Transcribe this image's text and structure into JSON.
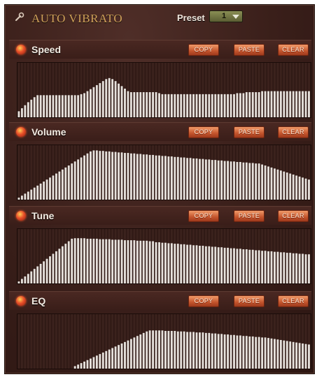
{
  "header": {
    "title": "AUTO VIBRATO",
    "preset_label": "Preset",
    "preset_value": "1"
  },
  "colors": {
    "accent": "#d2a25a",
    "button": "#c4542c",
    "graph_bg": "#2e1814",
    "bar": "#e6e1dc"
  },
  "sections": [
    {
      "label": "Speed",
      "copy": "COPY",
      "paste": "PASTE",
      "clear": "CLEAR",
      "envelope": [
        0.12,
        0.18,
        0.24,
        0.3,
        0.35,
        0.4,
        0.44,
        0.44,
        0.44,
        0.44,
        0.44,
        0.44,
        0.44,
        0.44,
        0.44,
        0.44,
        0.44,
        0.44,
        0.44,
        0.44,
        0.46,
        0.48,
        0.52,
        0.56,
        0.6,
        0.64,
        0.68,
        0.72,
        0.76,
        0.78,
        0.76,
        0.72,
        0.67,
        0.62,
        0.57,
        0.52,
        0.5,
        0.5,
        0.5,
        0.5,
        0.5,
        0.5,
        0.5,
        0.5,
        0.5,
        0.48,
        0.46,
        0.46,
        0.46,
        0.46,
        0.46,
        0.46,
        0.46,
        0.46,
        0.46,
        0.46,
        0.46,
        0.46,
        0.46,
        0.46,
        0.46,
        0.46,
        0.46,
        0.46,
        0.46,
        0.46,
        0.46,
        0.46,
        0.46,
        0.46,
        0.48,
        0.48,
        0.48,
        0.5,
        0.5,
        0.5,
        0.5,
        0.5,
        0.52,
        0.52,
        0.52,
        0.52,
        0.52,
        0.52,
        0.52,
        0.52,
        0.52,
        0.52,
        0.52,
        0.52,
        0.52,
        0.52,
        0.52,
        0.52
      ]
    },
    {
      "label": "Volume",
      "copy": "COPY",
      "paste": "PASTE",
      "clear": "CLEAR",
      "envelope": [
        0.04,
        0.08,
        0.12,
        0.16,
        0.2,
        0.24,
        0.28,
        0.32,
        0.36,
        0.4,
        0.44,
        0.48,
        0.52,
        0.56,
        0.6,
        0.64,
        0.68,
        0.72,
        0.76,
        0.8,
        0.84,
        0.88,
        0.92,
        0.96,
        0.98,
        0.98,
        0.97,
        0.97,
        0.96,
        0.96,
        0.95,
        0.95,
        0.94,
        0.94,
        0.93,
        0.93,
        0.92,
        0.92,
        0.91,
        0.91,
        0.9,
        0.9,
        0.89,
        0.89,
        0.88,
        0.88,
        0.87,
        0.87,
        0.86,
        0.86,
        0.85,
        0.85,
        0.84,
        0.84,
        0.83,
        0.83,
        0.82,
        0.82,
        0.81,
        0.81,
        0.8,
        0.8,
        0.79,
        0.79,
        0.78,
        0.78,
        0.77,
        0.77,
        0.76,
        0.76,
        0.75,
        0.75,
        0.74,
        0.74,
        0.73,
        0.73,
        0.72,
        0.72,
        0.7,
        0.68,
        0.66,
        0.64,
        0.62,
        0.6,
        0.58,
        0.56,
        0.54,
        0.52,
        0.5,
        0.48,
        0.46,
        0.44,
        0.42,
        0.4
      ]
    },
    {
      "label": "Tune",
      "copy": "COPY",
      "paste": "PASTE",
      "clear": "CLEAR",
      "envelope": [
        0.04,
        0.09,
        0.14,
        0.19,
        0.24,
        0.29,
        0.34,
        0.39,
        0.44,
        0.49,
        0.54,
        0.59,
        0.64,
        0.69,
        0.74,
        0.79,
        0.84,
        0.89,
        0.9,
        0.9,
        0.9,
        0.9,
        0.89,
        0.89,
        0.89,
        0.89,
        0.88,
        0.88,
        0.88,
        0.88,
        0.87,
        0.87,
        0.87,
        0.87,
        0.86,
        0.86,
        0.86,
        0.86,
        0.85,
        0.85,
        0.85,
        0.85,
        0.84,
        0.84,
        0.82,
        0.82,
        0.81,
        0.81,
        0.8,
        0.8,
        0.79,
        0.79,
        0.78,
        0.78,
        0.77,
        0.77,
        0.76,
        0.76,
        0.75,
        0.75,
        0.74,
        0.74,
        0.73,
        0.73,
        0.72,
        0.72,
        0.71,
        0.71,
        0.7,
        0.7,
        0.69,
        0.69,
        0.68,
        0.68,
        0.67,
        0.67,
        0.66,
        0.66,
        0.65,
        0.65,
        0.64,
        0.64,
        0.63,
        0.63,
        0.62,
        0.62,
        0.61,
        0.61,
        0.6,
        0.6,
        0.59,
        0.59,
        0.58,
        0.58
      ]
    },
    {
      "label": "EQ",
      "copy": "COPY",
      "paste": "PASTE",
      "clear": "CLEAR",
      "envelope": [
        0,
        0,
        0,
        0,
        0,
        0,
        0,
        0,
        0,
        0,
        0,
        0,
        0,
        0,
        0,
        0,
        0,
        0,
        0.05,
        0.08,
        0.11,
        0.14,
        0.17,
        0.2,
        0.23,
        0.26,
        0.29,
        0.32,
        0.35,
        0.38,
        0.41,
        0.44,
        0.47,
        0.5,
        0.53,
        0.56,
        0.59,
        0.62,
        0.65,
        0.68,
        0.71,
        0.74,
        0.76,
        0.76,
        0.76,
        0.76,
        0.76,
        0.75,
        0.75,
        0.75,
        0.75,
        0.74,
        0.74,
        0.74,
        0.73,
        0.73,
        0.73,
        0.72,
        0.72,
        0.72,
        0.71,
        0.71,
        0.7,
        0.7,
        0.69,
        0.69,
        0.68,
        0.68,
        0.67,
        0.67,
        0.66,
        0.66,
        0.65,
        0.65,
        0.64,
        0.64,
        0.63,
        0.63,
        0.62,
        0.62,
        0.61,
        0.6,
        0.59,
        0.58,
        0.57,
        0.56,
        0.55,
        0.54,
        0.53,
        0.52,
        0.51,
        0.5,
        0.49,
        0.48
      ]
    }
  ]
}
